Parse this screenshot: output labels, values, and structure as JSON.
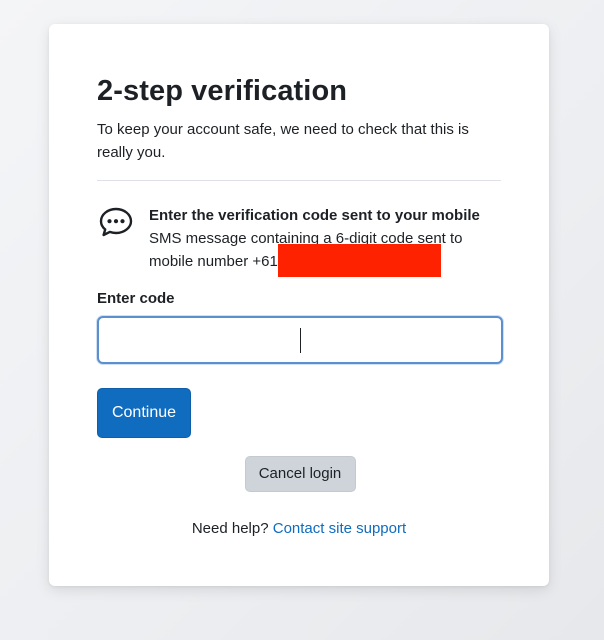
{
  "page": {
    "title": "2-step verification",
    "intro": "To keep your account safe, we need to check that this is really you."
  },
  "method": {
    "icon": "sms-chat-bubble-icon",
    "heading": "Enter the verification code sent to your mobile",
    "description": "SMS message containing a 6-digit code sent to mobile number +61"
  },
  "form": {
    "code_label": "Enter code",
    "code_value": "",
    "continue_label": "Continue",
    "cancel_label": "Cancel login"
  },
  "help": {
    "prefix": "Need help?",
    "link_label": "Contact site support"
  },
  "colors": {
    "primary": "#0f6cbf",
    "secondary_button": "#ced4da",
    "redaction": "#ff2200",
    "input_focus_border": "#5b8fcf"
  }
}
